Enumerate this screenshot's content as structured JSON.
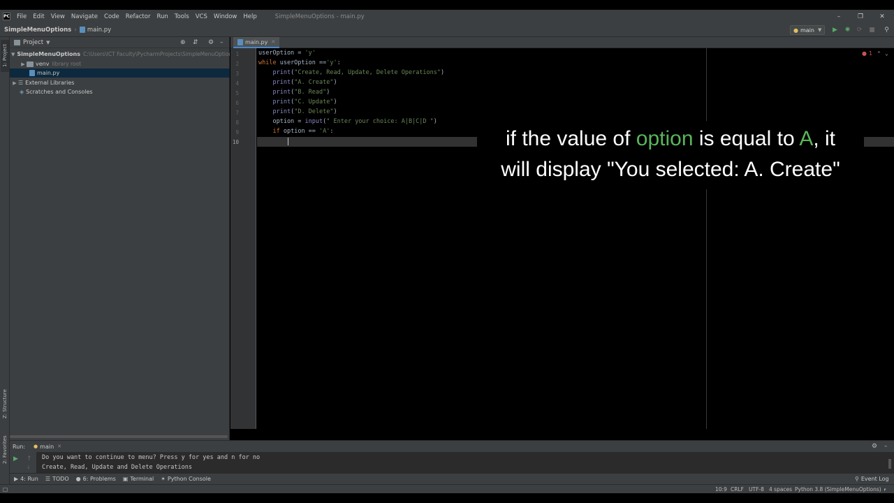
{
  "window": {
    "title": "SimpleMenuOptions - main.py",
    "menu": [
      "File",
      "Edit",
      "View",
      "Navigate",
      "Code",
      "Refactor",
      "Run",
      "Tools",
      "VCS",
      "Window",
      "Help"
    ]
  },
  "navbar": {
    "project": "SimpleMenuOptions",
    "file": "main.py",
    "run_config": "main"
  },
  "left_stripe": {
    "project_tab": "1: Project",
    "structure_tab": "Z: Structure",
    "favorites_tab": "2: Favorites"
  },
  "project_panel": {
    "header": "Project",
    "root_name": "SimpleMenuOptions",
    "root_path": "C:\\Users\\ICT Faculty\\PycharmProjects\\SimpleMenuOptions",
    "venv": "venv",
    "venv_hint": "library root",
    "main_file": "main.py",
    "external": "External Libraries",
    "scratches": "Scratches and Consoles"
  },
  "editor": {
    "tab": "main.py",
    "error_count": "1",
    "lines": [
      "1",
      "2",
      "3",
      "4",
      "5",
      "6",
      "7",
      "8",
      "9",
      "10"
    ]
  },
  "caption": {
    "part1": "if the value of ",
    "word1": "option",
    "part2": " is equal to ",
    "word2": "A",
    "part3": ", it",
    "line2": "will display \"You selected: A. Create\""
  },
  "run_panel": {
    "label": "Run:",
    "config": "main",
    "console_line1": "Do you want to continue to menu? Press y for yes and n for no",
    "console_line2": "Create, Read, Update and Delete Operations"
  },
  "bottom_tabs": {
    "run": "4: Run",
    "todo": "TODO",
    "problems": "6: Problems",
    "terminal": "Terminal",
    "python_console": "Python Console",
    "event_log": "Event Log"
  },
  "statusbar": {
    "position": "10:9",
    "line_sep": "CRLF",
    "encoding": "UTF-8",
    "indent": "4 spaces",
    "interpreter": "Python 3.8 (SimpleMenuOptions)"
  }
}
